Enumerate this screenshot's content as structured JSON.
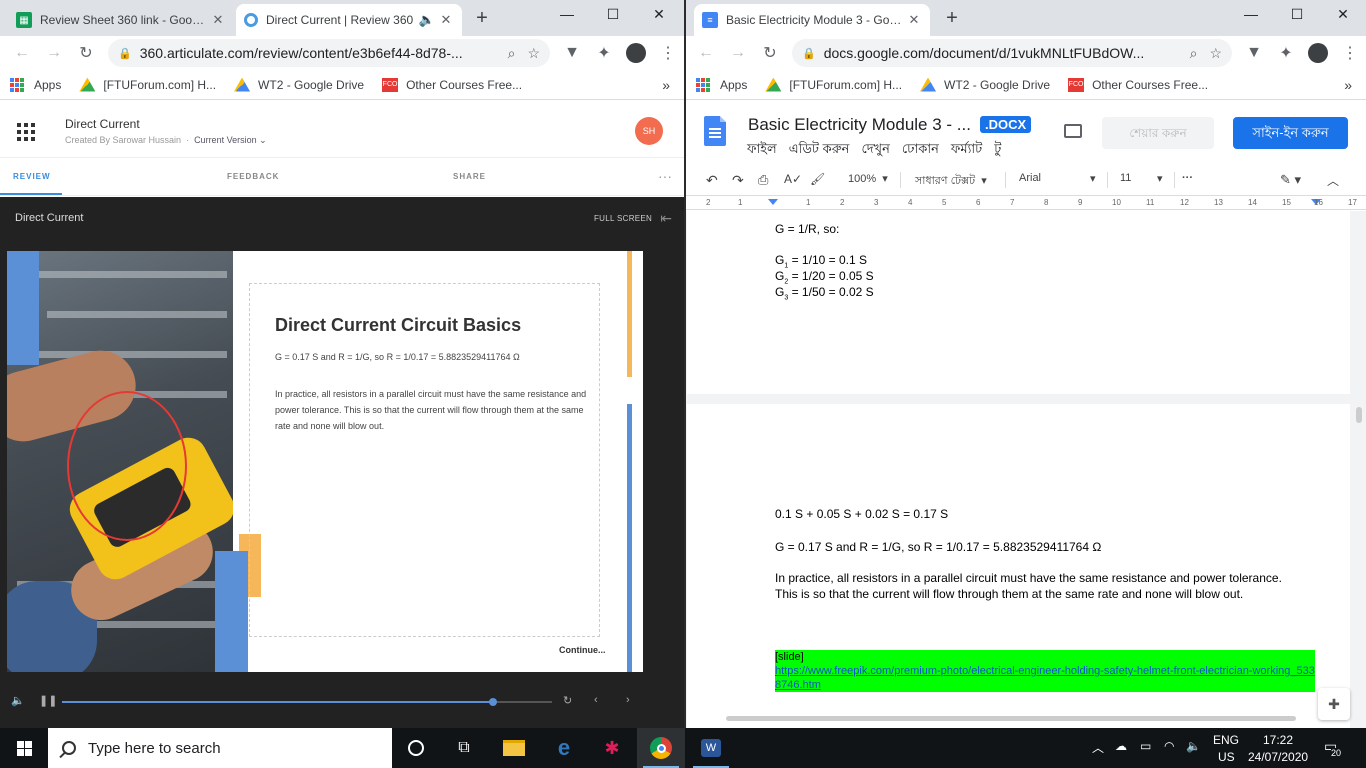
{
  "left_window": {
    "tabs": [
      {
        "title": "Review Sheet 360 link - Google Sheets",
        "active": false
      },
      {
        "title": "Direct Current | Review 360",
        "active": true
      }
    ],
    "url": "360.articulate.com/review/content/e3b6ef44-8d78-...",
    "bookmarks": [
      "Apps",
      "[FTUForum.com] H...",
      "WT2 - Google Drive",
      "Other Courses Free..."
    ],
    "article": {
      "title": "Direct Current",
      "created_by": "Created By Sarowar Hussain",
      "version": "Current Version",
      "avatar": "SH",
      "tabs": [
        "REVIEW",
        "FEEDBACK",
        "SHARE"
      ],
      "player_title": "Direct Current",
      "full_screen": "FULL SCREEN",
      "slide": {
        "heading": "Direct Current Circuit Basics",
        "equation": "G = 0.17 S and R = 1/G, so R = 1/0.17 =  5.8823529411764 Ω",
        "paragraph": "In practice, all resistors in a parallel circuit must have the same resistance and power tolerance. This is so that the current will flow through them at the same rate and none will blow out.",
        "continue": "Continue..."
      },
      "progress": 0.88
    }
  },
  "right_window": {
    "tabs": [
      {
        "title": "Basic Electricity Module 3 - Google Docs",
        "active": true
      }
    ],
    "url": "docs.google.com/document/d/1vukMNLtFUBdOW...",
    "bookmarks": [
      "Apps",
      "[FTUForum.com] H...",
      "WT2 - Google Drive",
      "Other Courses Free..."
    ],
    "doc": {
      "title": "Basic Electricity Module 3 - ...",
      "badge": ".DOCX",
      "menus": [
        "ফাইল",
        "এডিট করুন",
        "দেখুন",
        "ঢোকান",
        "ফর্ম্যাট",
        "টু"
      ],
      "share": "শেয়ার করুন",
      "signin": "সাইন-ইন করুন",
      "zoom": "100%",
      "style": "সাধারণ টেক্সট",
      "font": "Arial",
      "font_size": "11",
      "ruler": [
        "2",
        "1",
        "1",
        "2",
        "3",
        "4",
        "5",
        "6",
        "7",
        "8",
        "9",
        "10",
        "11",
        "12",
        "13",
        "14",
        "15",
        "16",
        "17"
      ],
      "page1": {
        "line1": "G = 1/R, so:",
        "g1": "= 1/10 = 0.1 S",
        "g2": "= 1/20 = 0.05 S",
        "g3": "= 1/50 = 0.02 S"
      },
      "page2": {
        "sum": "0.1 S + 0.05 S + 0.02 S = 0.17 S",
        "equation": "G = 0.17 S and R = 1/G, so R = 1/0.17 =  5.8823529411764 Ω",
        "paragraph": "In practice, all resistors in a parallel circuit must have the same resistance and power tolerance. This is so that the current will flow through them at the same rate and none will blow out.",
        "slide_tag": "[slide]",
        "link": "https://www.freepik.com/premium-photo/electrical-engineer-holding-safety-helmet-front-electrician-working_5338746.htm"
      }
    }
  },
  "taskbar": {
    "search_placeholder": "Type here to search",
    "lang_top": "ENG",
    "lang_bottom": "US",
    "time": "17:22",
    "date": "24/07/2020",
    "notifications": "20"
  },
  "colors": {
    "articulate_blue": "#5b8fd6",
    "articulate_orange": "#f5b759",
    "docs_blue": "#1a73e8",
    "highlight_green": "#00ff00"
  }
}
